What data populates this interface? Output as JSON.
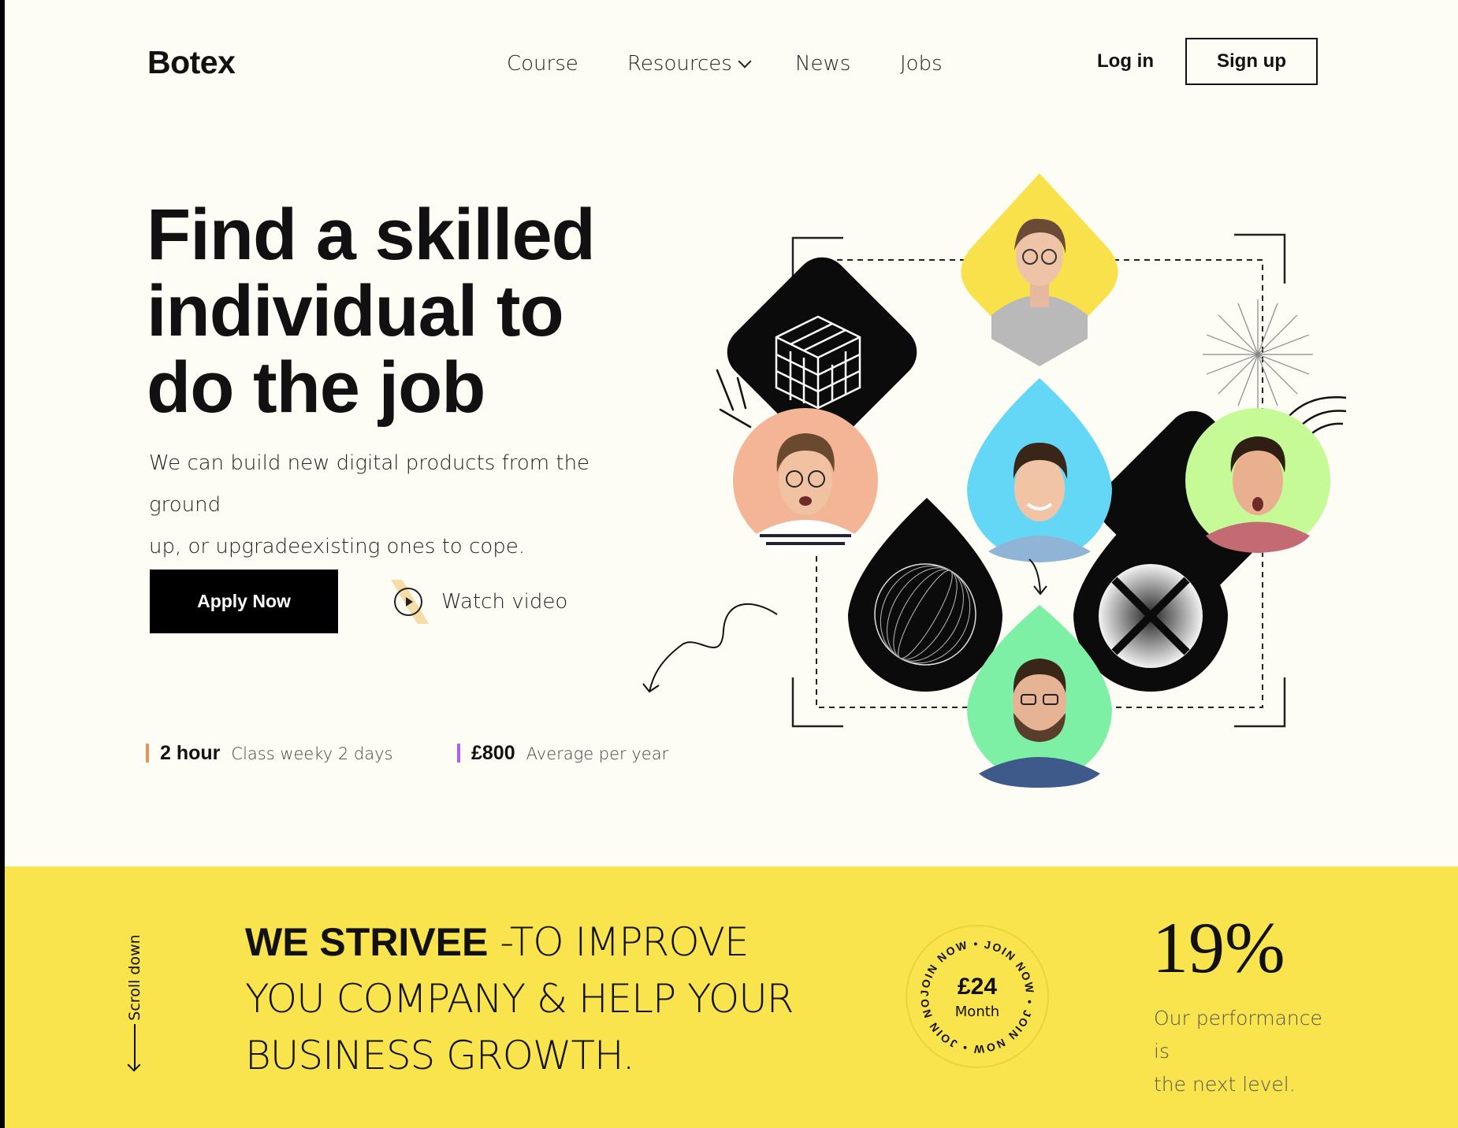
{
  "brand": {
    "name": "Botex"
  },
  "nav": {
    "items": [
      {
        "label": "Course"
      },
      {
        "label": "Resources"
      },
      {
        "label": "News"
      },
      {
        "label": "Jobs"
      }
    ],
    "login": "Log in",
    "signup": "Sign up"
  },
  "hero": {
    "title_line1": "Find a skilled",
    "title_line2": "individual to",
    "title_line3": "do the job",
    "subtitle_line1": "We can build new digital products from the ground",
    "subtitle_line2": "up, or upgradeexisting ones to cope.",
    "apply_label": "Apply Now",
    "watch_label": "Watch video"
  },
  "stats": [
    {
      "value": "2 hour",
      "desc": "Class weeky 2 days",
      "color": "#e8915a"
    },
    {
      "value": "£800",
      "desc": "Average per year",
      "color": "#b45ee8"
    }
  ],
  "band": {
    "scroll_label": "Scroll down",
    "headline_bold": "WE STRIVEE",
    "headline_rest1": " -TO IMPROVE",
    "headline_line2": "YOU COMPANY & HELP YOUR",
    "headline_line3": "BUSINESS GROWTH.",
    "badge_price": "£24",
    "badge_period": "Month",
    "badge_ring": "JOIN NOW • JOIN NOW • JOIN NOW • JOIN NOW • ",
    "percent": "19%",
    "percent_desc_line1": "Our performance is",
    "percent_desc_line2": "the next level."
  },
  "colors": {
    "band": "#fae44d",
    "yellow_shape": "#f8e14b",
    "peach_shape": "#f3b596",
    "blue_shape": "#64d6f6",
    "green_shape": "#c6fa96",
    "mint_shape": "#7df0a6"
  }
}
